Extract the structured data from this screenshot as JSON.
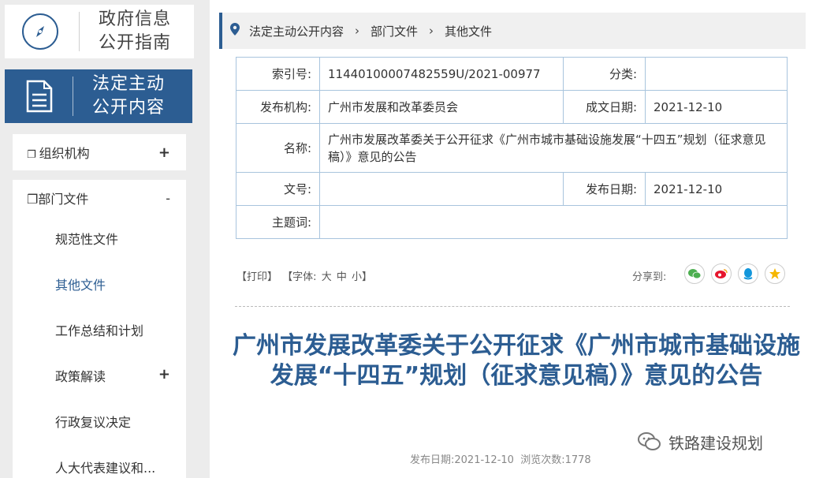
{
  "sidebar": {
    "guide_title_line1": "政府信息",
    "guide_title_line2": "公开指南",
    "legal_title_line1": "法定主动",
    "legal_title_line2": "公开内容",
    "org_label": "组织机构",
    "org_sign": "+",
    "dept_label": "部门文件",
    "dept_sign": "-",
    "sub_items": [
      "规范性文件",
      "其他文件",
      "工作总结和计划",
      "政策解读",
      "行政复议决定",
      "人大代表建议和..."
    ],
    "policy_sign": "+"
  },
  "breadcrumb": [
    "法定主动公开内容",
    "部门文件",
    "其他文件"
  ],
  "meta": {
    "index_label": "索引号:",
    "index_value": "11440100007482559U/2021-00977",
    "category_label": "分类:",
    "category_value": "",
    "publisher_label": "发布机构:",
    "publisher_value": "广州市发展和改革委员会",
    "written_date_label": "成文日期:",
    "written_date_value": "2021-12-10",
    "name_label": "名称:",
    "name_value": "广州市发展改革委关于公开征求《广州市城市基础设施发展“十四五”规划（征求意见稿）》意见的公告",
    "docno_label": "文号:",
    "docno_value": "",
    "pub_date_label": "发布日期:",
    "pub_date_value": "2021-12-10",
    "subject_label": "主题词:",
    "subject_value": ""
  },
  "tools": {
    "print": "【打印】",
    "font_prefix": "【字体:",
    "large": "大",
    "medium": "中",
    "small": "小】",
    "share_label": "分享到:"
  },
  "article": {
    "title": "广州市发展改革委关于公开征求《广州市城市基础设施发展“十四五”规划（征求意见稿）》意见的公告",
    "pub_date_label": "发布日期:",
    "pub_date": "2021-12-10",
    "views_label": "浏览次数:",
    "views": "1778"
  },
  "watermark": "铁路建设规划",
  "colors": {
    "accent": "#2c5d92",
    "table_border": "#a8c4dd",
    "wechat": "#4caf50",
    "weibo": "#e6162d",
    "qq": "#1296db",
    "qzone": "#f5b700"
  }
}
